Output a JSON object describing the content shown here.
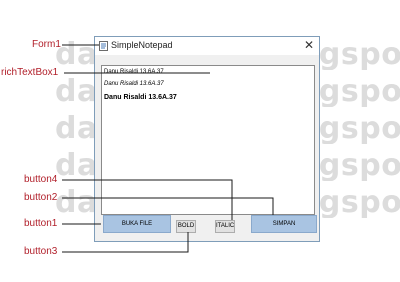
{
  "watermark": [
    "dansrisaldy.blogspot.co.id",
    "dansrisaldy.blogspot.co.id",
    "dansrisaldy.blogspot.co.id",
    "dansrisaldy.blogspot.co.id",
    "dansrisaldy.blogspot.co.id"
  ],
  "callouts": {
    "form1": "Form1",
    "richtextbox1": "richTextBox1",
    "button4": "button4",
    "button2": "button2",
    "button1": "button1",
    "button3": "button3"
  },
  "window": {
    "title": "SimpleNotepad",
    "close_glyph": "✕",
    "icon": "notepad-icon"
  },
  "richtextbox": {
    "lines": [
      "Danu Risaldi 13.6A.37",
      "Danu Risaldi 13.6A.37",
      "Danu Risaldi 13.6A.37"
    ]
  },
  "buttons": {
    "buka_file": "BUKA FILE",
    "bold": "BOLD",
    "italic": "ITALIC",
    "simpan": "SIMPAN"
  },
  "colors": {
    "callout": "#b11f2a",
    "primary_button": "#a9c4e2",
    "watermark": "#dcdcdc"
  }
}
